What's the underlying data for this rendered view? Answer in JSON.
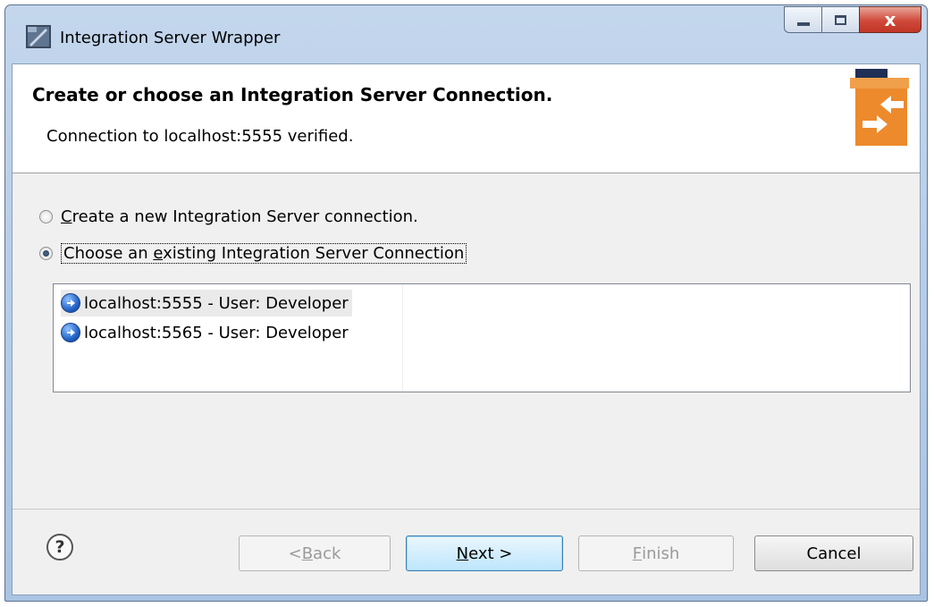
{
  "window": {
    "title": "Integration Server Wrapper",
    "icon": "integration-server-app-icon",
    "controls": {
      "minimize": "minimize-icon",
      "maximize": "maximize-icon",
      "close": "x"
    }
  },
  "banner": {
    "title": "Create or choose an Integration Server Connection.",
    "message": "Connection to localhost:5555 verified.",
    "icon": "integration-connection-wizard-icon"
  },
  "options": {
    "create_new": {
      "prefix": "",
      "mnemonic": "C",
      "suffix": "reate a new Integration Server connection.",
      "selected": false
    },
    "choose_existing": {
      "prefix": "Choose an ",
      "mnemonic": "e",
      "suffix": "xisting Integration Server Connection",
      "selected": true
    }
  },
  "connections": [
    {
      "label": "localhost:5555 - User: Developer",
      "icon": "server-connection-icon",
      "selected": true
    },
    {
      "label": "localhost:5565 - User: Developer",
      "icon": "server-connection-icon",
      "selected": false
    }
  ],
  "buttons": {
    "help": "?",
    "back": {
      "prefix": "< ",
      "mnemonic": "B",
      "suffix": "ack",
      "enabled": false
    },
    "next": {
      "prefix": "",
      "mnemonic": "N",
      "suffix": "ext >",
      "enabled": true
    },
    "finish": {
      "prefix": "",
      "mnemonic": "F",
      "suffix": "inish",
      "enabled": false
    },
    "cancel": {
      "label": "Cancel",
      "enabled": true
    }
  },
  "colors": {
    "accent_orange": "#ec8a2c",
    "title_bar": "#b9cfe9",
    "close_red": "#c94431"
  }
}
